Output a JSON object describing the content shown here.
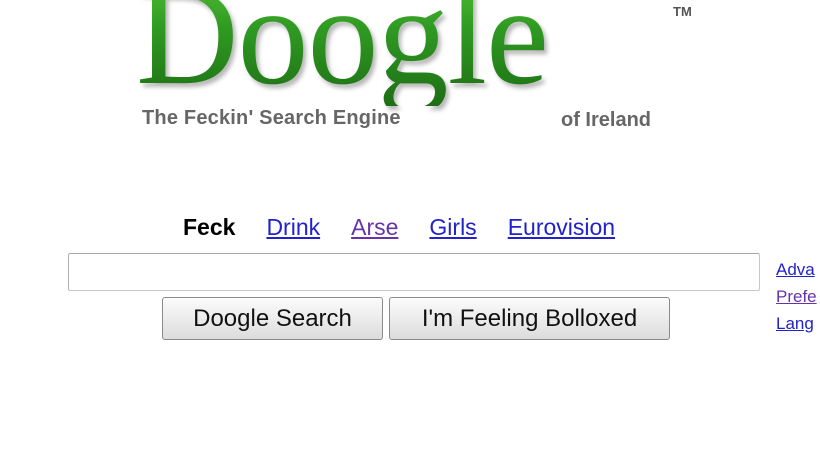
{
  "logo": {
    "text": "Doogle",
    "trademark": "TM",
    "tagline_left": "The Feckin' Search Engine",
    "tagline_right": "of Ireland"
  },
  "nav": {
    "items": [
      {
        "label": "Feck",
        "active": true
      },
      {
        "label": "Drink",
        "active": false
      },
      {
        "label": "Arse",
        "active": false
      },
      {
        "label": "Girls",
        "active": false
      },
      {
        "label": "Eurovision",
        "active": false
      }
    ]
  },
  "search": {
    "value": "",
    "placeholder": ""
  },
  "side_links": [
    "Adva",
    "Prefe",
    "Lang"
  ],
  "buttons": {
    "search_label": "Doogle Search",
    "lucky_label": "I'm Feeling Bolloxed"
  },
  "colors": {
    "logo_green": "#2f9a22",
    "link_blue": "#2222cc",
    "link_visited": "#6633aa",
    "tagline_gray": "#666666"
  }
}
